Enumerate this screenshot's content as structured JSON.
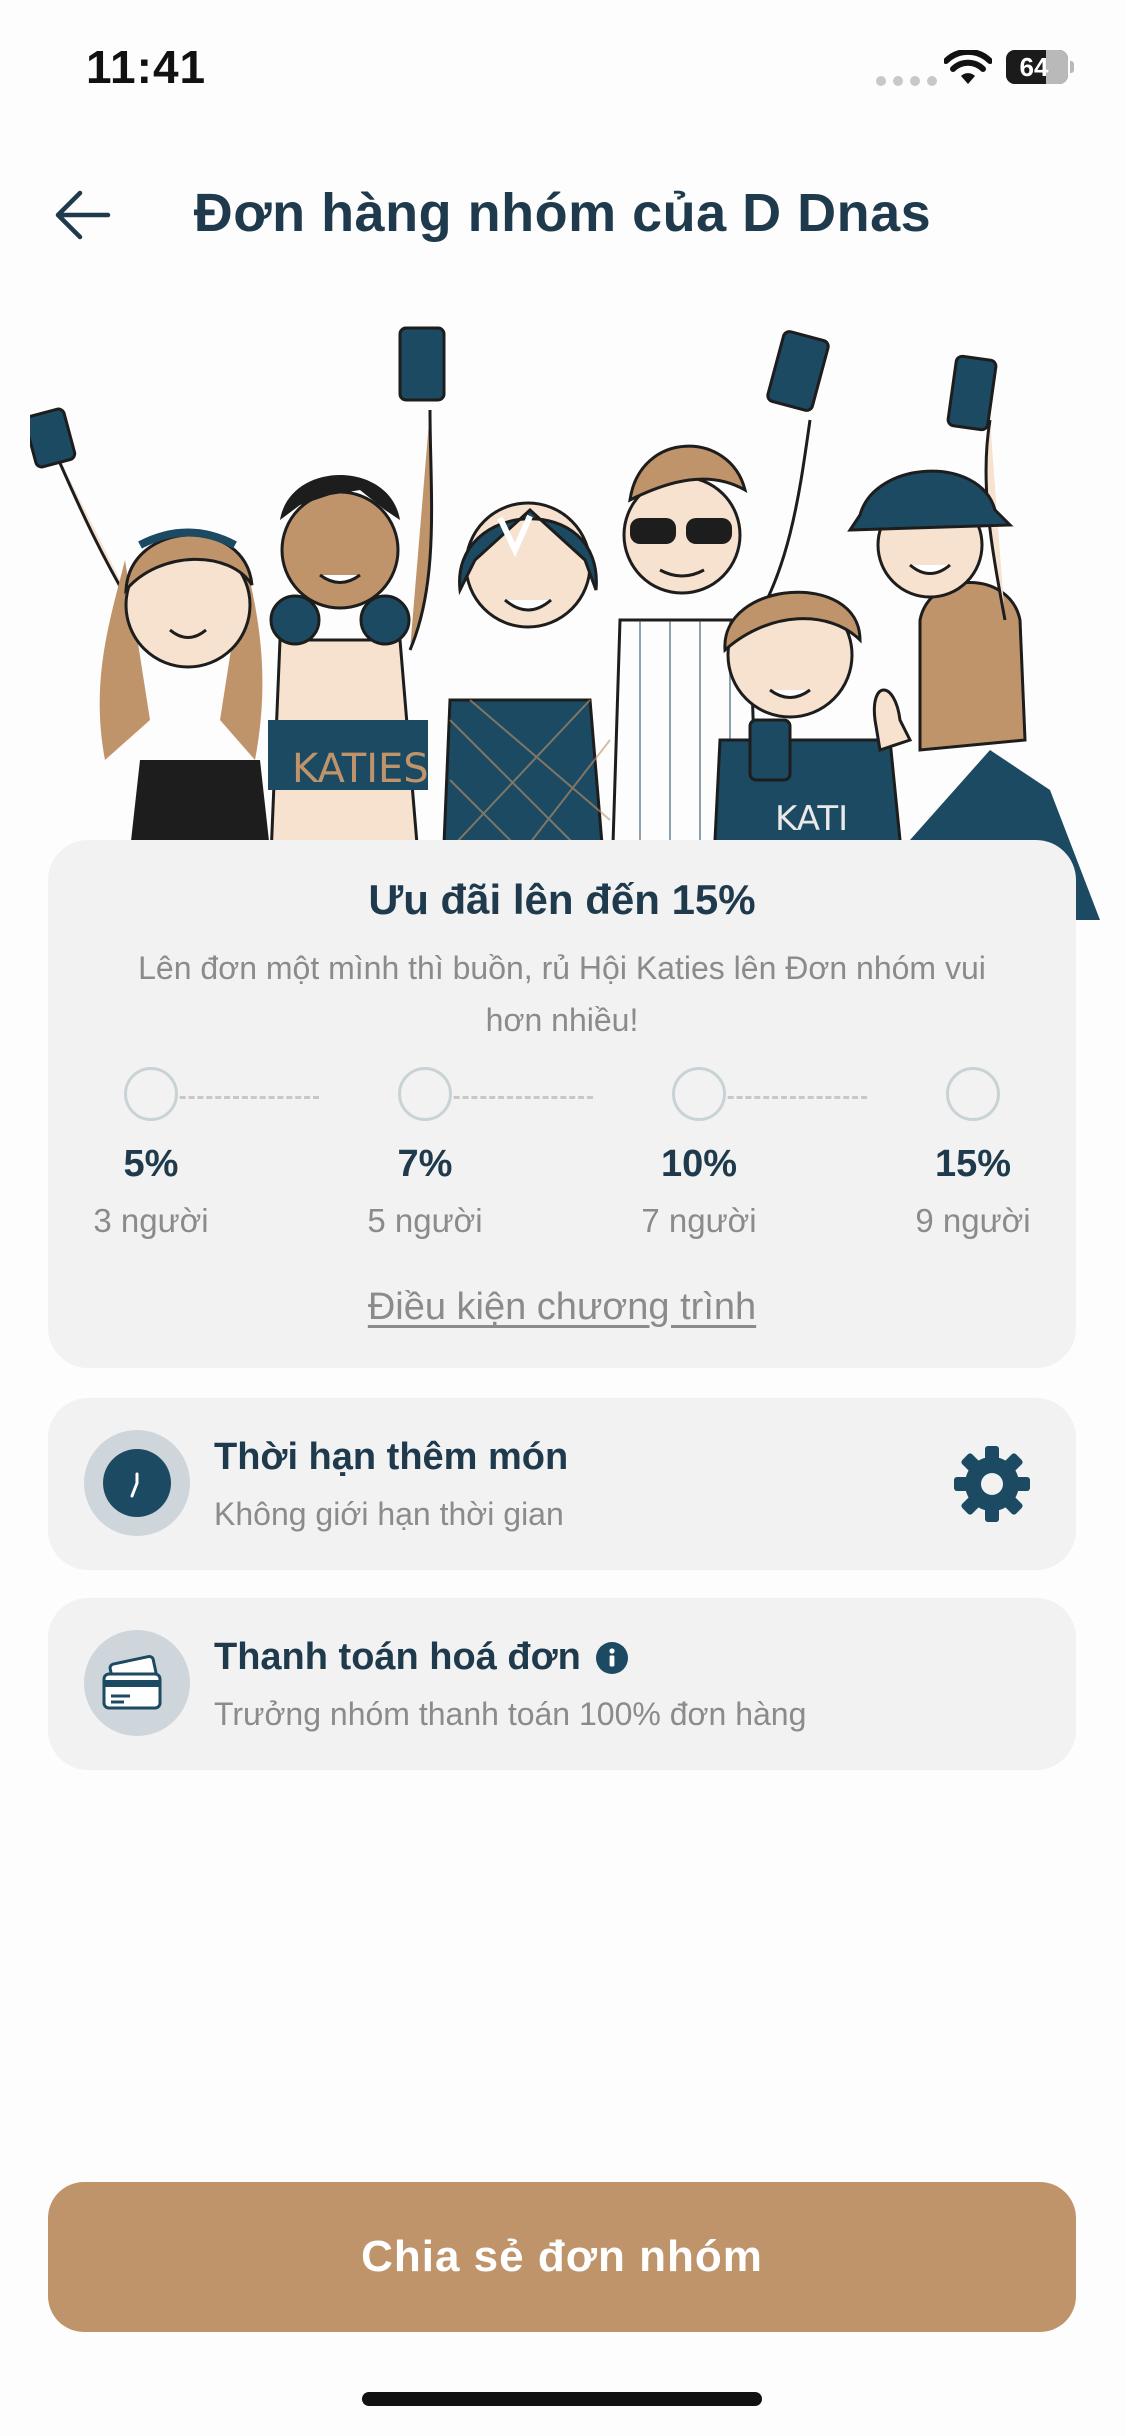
{
  "status_bar": {
    "time": "11:41",
    "battery_label": "64",
    "battery_level": 0.64
  },
  "header": {
    "title": "Đơn hàng nhóm của D Dnas"
  },
  "hero": {
    "shirt_text": "KATIES",
    "shirt_text_2": "KATI",
    "colors": {
      "navy": "#1c4a62",
      "tan": "#c0946a",
      "skin": "#f6e2cf",
      "ink": "#1d1d1d"
    }
  },
  "promo": {
    "title": "Ưu đãi lên đến 15%",
    "description": "Lên đơn một mình thì buồn, rủ Hội Katies lên Đơn nhóm vui hơn nhiều!",
    "tiers": [
      {
        "percent": "5%",
        "people": "3 người"
      },
      {
        "percent": "7%",
        "people": "5 người"
      },
      {
        "percent": "10%",
        "people": "7 người"
      },
      {
        "percent": "15%",
        "people": "9 người"
      }
    ],
    "conditions_link": "Điều kiện chương trình"
  },
  "time_limit": {
    "title": "Thời hạn thêm món",
    "subtitle": "Không giới hạn thời gian",
    "icon": "clock-icon",
    "action_icon": "gear-icon"
  },
  "payment": {
    "title": "Thanh toán hoá đơn",
    "subtitle": "Trưởng nhóm thanh toán 100% đơn hàng",
    "icon": "payment-card-icon",
    "info_icon": "info-icon"
  },
  "share_button": {
    "label": "Chia sẻ đơn nhóm"
  },
  "theme": {
    "primary": "#1e3a4c",
    "accent": "#c0946a",
    "card_bg": "#f2f2f2",
    "muted_text": "#8b8b8b"
  }
}
